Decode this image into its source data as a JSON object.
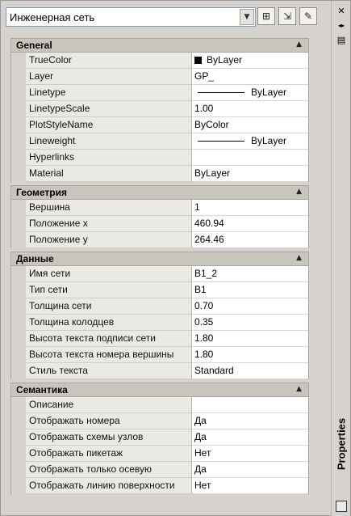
{
  "header": {
    "combo_value": "Инженерная сеть",
    "combo_arrow_icon": "chevron-down-icon",
    "buttons": [
      {
        "icon": "toggle-pickadd-icon",
        "glyph": "⊞"
      },
      {
        "icon": "select-objects-icon",
        "glyph": "⇲"
      },
      {
        "icon": "quick-select-icon",
        "glyph": "✎"
      }
    ]
  },
  "side": {
    "close_glyph": "✕",
    "autohide_glyph": "◂▸",
    "menu_glyph": "▤",
    "title": "Properties"
  },
  "sections": [
    {
      "title": "General",
      "collapse": "▲",
      "rows": [
        {
          "name": "TrueColor",
          "value": "ByLayer",
          "kind": "color"
        },
        {
          "name": "Layer",
          "value": "GP_",
          "kind": "text"
        },
        {
          "name": "Linetype",
          "value": "ByLayer",
          "kind": "line"
        },
        {
          "name": "LinetypeScale",
          "value": "1.00",
          "kind": "text"
        },
        {
          "name": "PlotStyleName",
          "value": "ByColor",
          "kind": "text"
        },
        {
          "name": "Lineweight",
          "value": "ByLayer",
          "kind": "line"
        },
        {
          "name": "Hyperlinks",
          "value": "",
          "kind": "text"
        },
        {
          "name": "Material",
          "value": "ByLayer",
          "kind": "text"
        }
      ]
    },
    {
      "title": "Геометрия",
      "collapse": "▲",
      "rows": [
        {
          "name": "Вершина",
          "value": "1",
          "kind": "text"
        },
        {
          "name": "Положение x",
          "value": "460.94",
          "kind": "text"
        },
        {
          "name": "Положение y",
          "value": "264.46",
          "kind": "text"
        }
      ]
    },
    {
      "title": "Данные",
      "collapse": "▲",
      "rows": [
        {
          "name": "Имя сети",
          "value": "B1_2",
          "kind": "text"
        },
        {
          "name": "Тип сети",
          "value": "B1",
          "kind": "text"
        },
        {
          "name": "Толщина сети",
          "value": "0.70",
          "kind": "text"
        },
        {
          "name": "Толщина колодцев",
          "value": "0.35",
          "kind": "text"
        },
        {
          "name": "Высота текста подписи сети",
          "value": "1.80",
          "kind": "text"
        },
        {
          "name": "Высота текста номера вершины",
          "value": "1.80",
          "kind": "text"
        },
        {
          "name": "Стиль текста",
          "value": "Standard",
          "kind": "text"
        }
      ]
    },
    {
      "title": "Семантика",
      "collapse": "▲",
      "rows": [
        {
          "name": "Описание",
          "value": "",
          "kind": "text"
        },
        {
          "name": "Отображать номера",
          "value": "Да",
          "kind": "text"
        },
        {
          "name": "Отображать схемы узлов",
          "value": "Да",
          "kind": "text"
        },
        {
          "name": "Отображать пикетаж",
          "value": "Нет",
          "kind": "text"
        },
        {
          "name": "Отображать только осевую",
          "value": "Да",
          "kind": "text"
        },
        {
          "name": "Отображать линию поверхности",
          "value": "Нет",
          "kind": "text"
        }
      ]
    }
  ]
}
